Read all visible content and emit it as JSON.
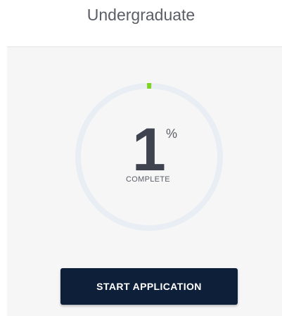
{
  "header": {
    "title": "Undergraduate"
  },
  "progress": {
    "percent_value": "1",
    "percent_sign": "%",
    "label": "COMPLETE",
    "fraction": 0.01,
    "colors": {
      "track": "#e8eef4",
      "fill": "#7ed321"
    }
  },
  "actions": {
    "start_label": "START APPLICATION",
    "button_color": "#0e1f3a"
  }
}
